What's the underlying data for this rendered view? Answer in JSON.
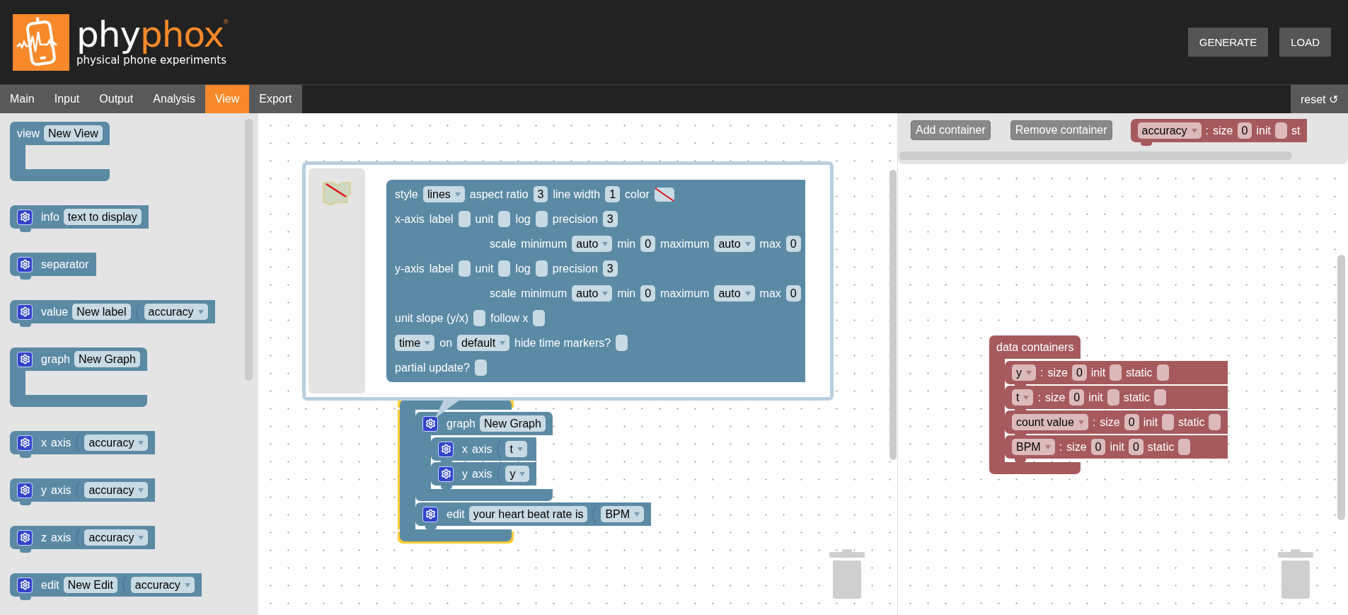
{
  "header": {
    "logo_text_1": "phy",
    "logo_text_2": "phox",
    "registered_mark": "®",
    "tagline": "physical phone experiments",
    "buttons": [
      "GENERATE",
      "LOAD"
    ]
  },
  "tabs": [
    {
      "label": "Main",
      "selected": false
    },
    {
      "label": "Input",
      "selected": false
    },
    {
      "label": "Output",
      "selected": false
    },
    {
      "label": "Analysis",
      "selected": false
    },
    {
      "label": "View",
      "selected": true
    },
    {
      "label": "Export",
      "selected": false
    }
  ],
  "reset_button": "reset ↺",
  "toolbox": [
    {
      "kind": "container",
      "gear": false,
      "parts": [
        {
          "kind": "label",
          "text": "view"
        },
        {
          "kind": "field",
          "text": "New View"
        }
      ]
    },
    {
      "kind": "statement",
      "gear": true,
      "parts": [
        {
          "kind": "label",
          "text": "info"
        },
        {
          "kind": "field",
          "text": "text to display"
        }
      ]
    },
    {
      "kind": "statement",
      "gear": true,
      "parts": [
        {
          "kind": "label",
          "text": "separator"
        }
      ]
    },
    {
      "kind": "statement",
      "gear": true,
      "parts": [
        {
          "kind": "label",
          "text": "value"
        },
        {
          "kind": "field",
          "text": "New label"
        },
        {
          "kind": "socket"
        },
        {
          "kind": "dropdown",
          "text": "accuracy"
        }
      ]
    },
    {
      "kind": "container",
      "gear": true,
      "parts": [
        {
          "kind": "label",
          "text": "graph"
        },
        {
          "kind": "field",
          "text": "New Graph"
        }
      ]
    },
    {
      "kind": "statement",
      "gear": true,
      "parts": [
        {
          "kind": "label",
          "text": "x"
        },
        {
          "kind": "label",
          "text": "axis"
        },
        {
          "kind": "socket"
        },
        {
          "kind": "dropdown",
          "text": "accuracy"
        }
      ]
    },
    {
      "kind": "statement",
      "gear": true,
      "parts": [
        {
          "kind": "label",
          "text": "y"
        },
        {
          "kind": "label",
          "text": "axis"
        },
        {
          "kind": "socket"
        },
        {
          "kind": "dropdown",
          "text": "accuracy"
        }
      ]
    },
    {
      "kind": "statement",
      "gear": true,
      "parts": [
        {
          "kind": "label",
          "text": "z"
        },
        {
          "kind": "label",
          "text": "axis"
        },
        {
          "kind": "socket"
        },
        {
          "kind": "dropdown",
          "text": "accuracy"
        }
      ]
    },
    {
      "kind": "statement",
      "gear": true,
      "parts": [
        {
          "kind": "label",
          "text": "edit"
        },
        {
          "kind": "field",
          "text": "New Edit"
        },
        {
          "kind": "socket"
        },
        {
          "kind": "dropdown",
          "text": "accuracy"
        }
      ]
    }
  ],
  "workspace": {
    "mutator": {
      "rows": [
        {
          "indented": false,
          "parts": [
            {
              "kind": "label",
              "text": "style"
            },
            {
              "kind": "dropdown",
              "text": "lines"
            },
            {
              "kind": "label",
              "text": "aspect ratio"
            },
            {
              "kind": "field",
              "text": "3"
            },
            {
              "kind": "label",
              "text": "line width"
            },
            {
              "kind": "field",
              "text": "1"
            },
            {
              "kind": "label",
              "text": "color"
            },
            {
              "kind": "nocolor"
            }
          ]
        },
        {
          "indented": false,
          "parts": [
            {
              "kind": "label",
              "text": "x-axis"
            },
            {
              "kind": "label",
              "text": "label"
            },
            {
              "kind": "checkbox",
              "checked": false
            },
            {
              "kind": "label",
              "text": "unit"
            },
            {
              "kind": "checkbox",
              "checked": false
            },
            {
              "kind": "label",
              "text": "log"
            },
            {
              "kind": "checkbox",
              "checked": false
            },
            {
              "kind": "label",
              "text": "precision"
            },
            {
              "kind": "field",
              "text": "3"
            }
          ]
        },
        {
          "indented": true,
          "parts": [
            {
              "kind": "label",
              "text": "scale"
            },
            {
              "kind": "label",
              "text": "minimum"
            },
            {
              "kind": "dropdown",
              "text": "auto"
            },
            {
              "kind": "label",
              "text": "min"
            },
            {
              "kind": "field",
              "text": "0"
            },
            {
              "kind": "label",
              "text": "maximum"
            },
            {
              "kind": "dropdown",
              "text": "auto"
            },
            {
              "kind": "label",
              "text": "max"
            },
            {
              "kind": "field",
              "text": "0"
            }
          ]
        },
        {
          "indented": false,
          "parts": [
            {
              "kind": "label",
              "text": "y-axis"
            },
            {
              "kind": "label",
              "text": "label"
            },
            {
              "kind": "checkbox",
              "checked": false
            },
            {
              "kind": "label",
              "text": "unit"
            },
            {
              "kind": "checkbox",
              "checked": false
            },
            {
              "kind": "label",
              "text": "log"
            },
            {
              "kind": "checkbox",
              "checked": false
            },
            {
              "kind": "label",
              "text": "precision"
            },
            {
              "kind": "field",
              "text": "3"
            }
          ]
        },
        {
          "indented": true,
          "parts": [
            {
              "kind": "label",
              "text": "scale"
            },
            {
              "kind": "label",
              "text": "minimum"
            },
            {
              "kind": "dropdown",
              "text": "auto"
            },
            {
              "kind": "label",
              "text": "min"
            },
            {
              "kind": "field",
              "text": "0"
            },
            {
              "kind": "label",
              "text": "maximum"
            },
            {
              "kind": "dropdown",
              "text": "auto"
            },
            {
              "kind": "label",
              "text": "max"
            },
            {
              "kind": "field",
              "text": "0"
            }
          ]
        },
        {
          "indented": false,
          "parts": [
            {
              "kind": "label",
              "text": "unit slope (y/x)"
            },
            {
              "kind": "checkbox",
              "checked": false
            },
            {
              "kind": "label",
              "text": "follow x"
            },
            {
              "kind": "checkbox",
              "checked": false
            }
          ]
        },
        {
          "indented": false,
          "parts": [
            {
              "kind": "dropdown",
              "text": "time"
            },
            {
              "kind": "label",
              "text": "on"
            },
            {
              "kind": "dropdown",
              "text": "default"
            },
            {
              "kind": "label",
              "text": "hide time markers?"
            },
            {
              "kind": "checkbox",
              "checked": false
            }
          ]
        },
        {
          "indented": false,
          "parts": [
            {
              "kind": "label",
              "text": "partial update?"
            },
            {
              "kind": "checkbox",
              "checked": false
            }
          ]
        }
      ]
    },
    "view_block": {
      "kind": "container",
      "gear": false,
      "selected": true,
      "children": [
        {
          "kind": "container",
          "gear": true,
          "parts": [
            {
              "kind": "label",
              "text": "graph"
            },
            {
              "kind": "field",
              "text": "New Graph"
            }
          ],
          "children": [
            {
              "kind": "statement",
              "gear": true,
              "parts": [
                {
                  "kind": "label",
                  "text": "x"
                },
                {
                  "kind": "label",
                  "text": "axis"
                },
                {
                  "kind": "socket"
                },
                {
                  "kind": "dropdown",
                  "text": "t"
                }
              ]
            },
            {
              "kind": "statement",
              "gear": true,
              "parts": [
                {
                  "kind": "label",
                  "text": "y"
                },
                {
                  "kind": "label",
                  "text": "axis"
                },
                {
                  "kind": "socket"
                },
                {
                  "kind": "dropdown",
                  "text": "y"
                }
              ]
            }
          ]
        },
        {
          "kind": "statement",
          "gear": true,
          "parts": [
            {
              "kind": "label",
              "text": "edit"
            },
            {
              "kind": "field",
              "text": "your heart beat rate is"
            },
            {
              "kind": "socket"
            },
            {
              "kind": "dropdown",
              "text": "BPM"
            }
          ]
        }
      ]
    }
  },
  "containers": {
    "buttons": [
      "Add container",
      "Remove container"
    ],
    "flyout_block": {
      "kind": "statement",
      "gear": false,
      "parts": [
        {
          "kind": "dropdown",
          "text": "accuracy"
        },
        {
          "kind": "label",
          "text": ":"
        },
        {
          "kind": "label",
          "text": "size"
        },
        {
          "kind": "field",
          "text": "0"
        },
        {
          "kind": "label",
          "text": "init"
        },
        {
          "kind": "checkbox",
          "checked": false
        },
        {
          "kind": "label",
          "text": "st"
        }
      ]
    },
    "data_block": {
      "kind": "container",
      "gear": false,
      "parts": [
        {
          "kind": "label",
          "text": "data containers"
        }
      ],
      "children": [
        {
          "kind": "statement",
          "gear": false,
          "parts": [
            {
              "kind": "dropdown",
              "text": "y"
            },
            {
              "kind": "label",
              "text": ":"
            },
            {
              "kind": "label",
              "text": "size"
            },
            {
              "kind": "field",
              "text": "0"
            },
            {
              "kind": "label",
              "text": "init"
            },
            {
              "kind": "checkbox",
              "checked": false
            },
            {
              "kind": "label",
              "text": "static"
            },
            {
              "kind": "checkbox",
              "checked": false
            }
          ]
        },
        {
          "kind": "statement",
          "gear": false,
          "parts": [
            {
              "kind": "dropdown",
              "text": "t"
            },
            {
              "kind": "label",
              "text": ":"
            },
            {
              "kind": "label",
              "text": "size"
            },
            {
              "kind": "field",
              "text": "0"
            },
            {
              "kind": "label",
              "text": "init"
            },
            {
              "kind": "checkbox",
              "checked": false
            },
            {
              "kind": "label",
              "text": "static"
            },
            {
              "kind": "checkbox",
              "checked": false
            }
          ]
        },
        {
          "kind": "statement",
          "gear": false,
          "parts": [
            {
              "kind": "dropdown",
              "text": "count value"
            },
            {
              "kind": "label",
              "text": ":"
            },
            {
              "kind": "label",
              "text": "size"
            },
            {
              "kind": "field",
              "text": "0"
            },
            {
              "kind": "label",
              "text": "init"
            },
            {
              "kind": "checkbox",
              "checked": false
            },
            {
              "kind": "label",
              "text": "static"
            },
            {
              "kind": "checkbox",
              "checked": false
            }
          ]
        },
        {
          "kind": "statement",
          "gear": false,
          "parts": [
            {
              "kind": "dropdown",
              "text": "BPM"
            },
            {
              "kind": "label",
              "text": ":"
            },
            {
              "kind": "label",
              "text": "size"
            },
            {
              "kind": "field",
              "text": "0"
            },
            {
              "kind": "label",
              "text": "init"
            },
            {
              "kind": "field",
              "text": "0"
            },
            {
              "kind": "label",
              "text": "static"
            },
            {
              "kind": "checkbox",
              "checked": false
            }
          ]
        }
      ]
    }
  }
}
